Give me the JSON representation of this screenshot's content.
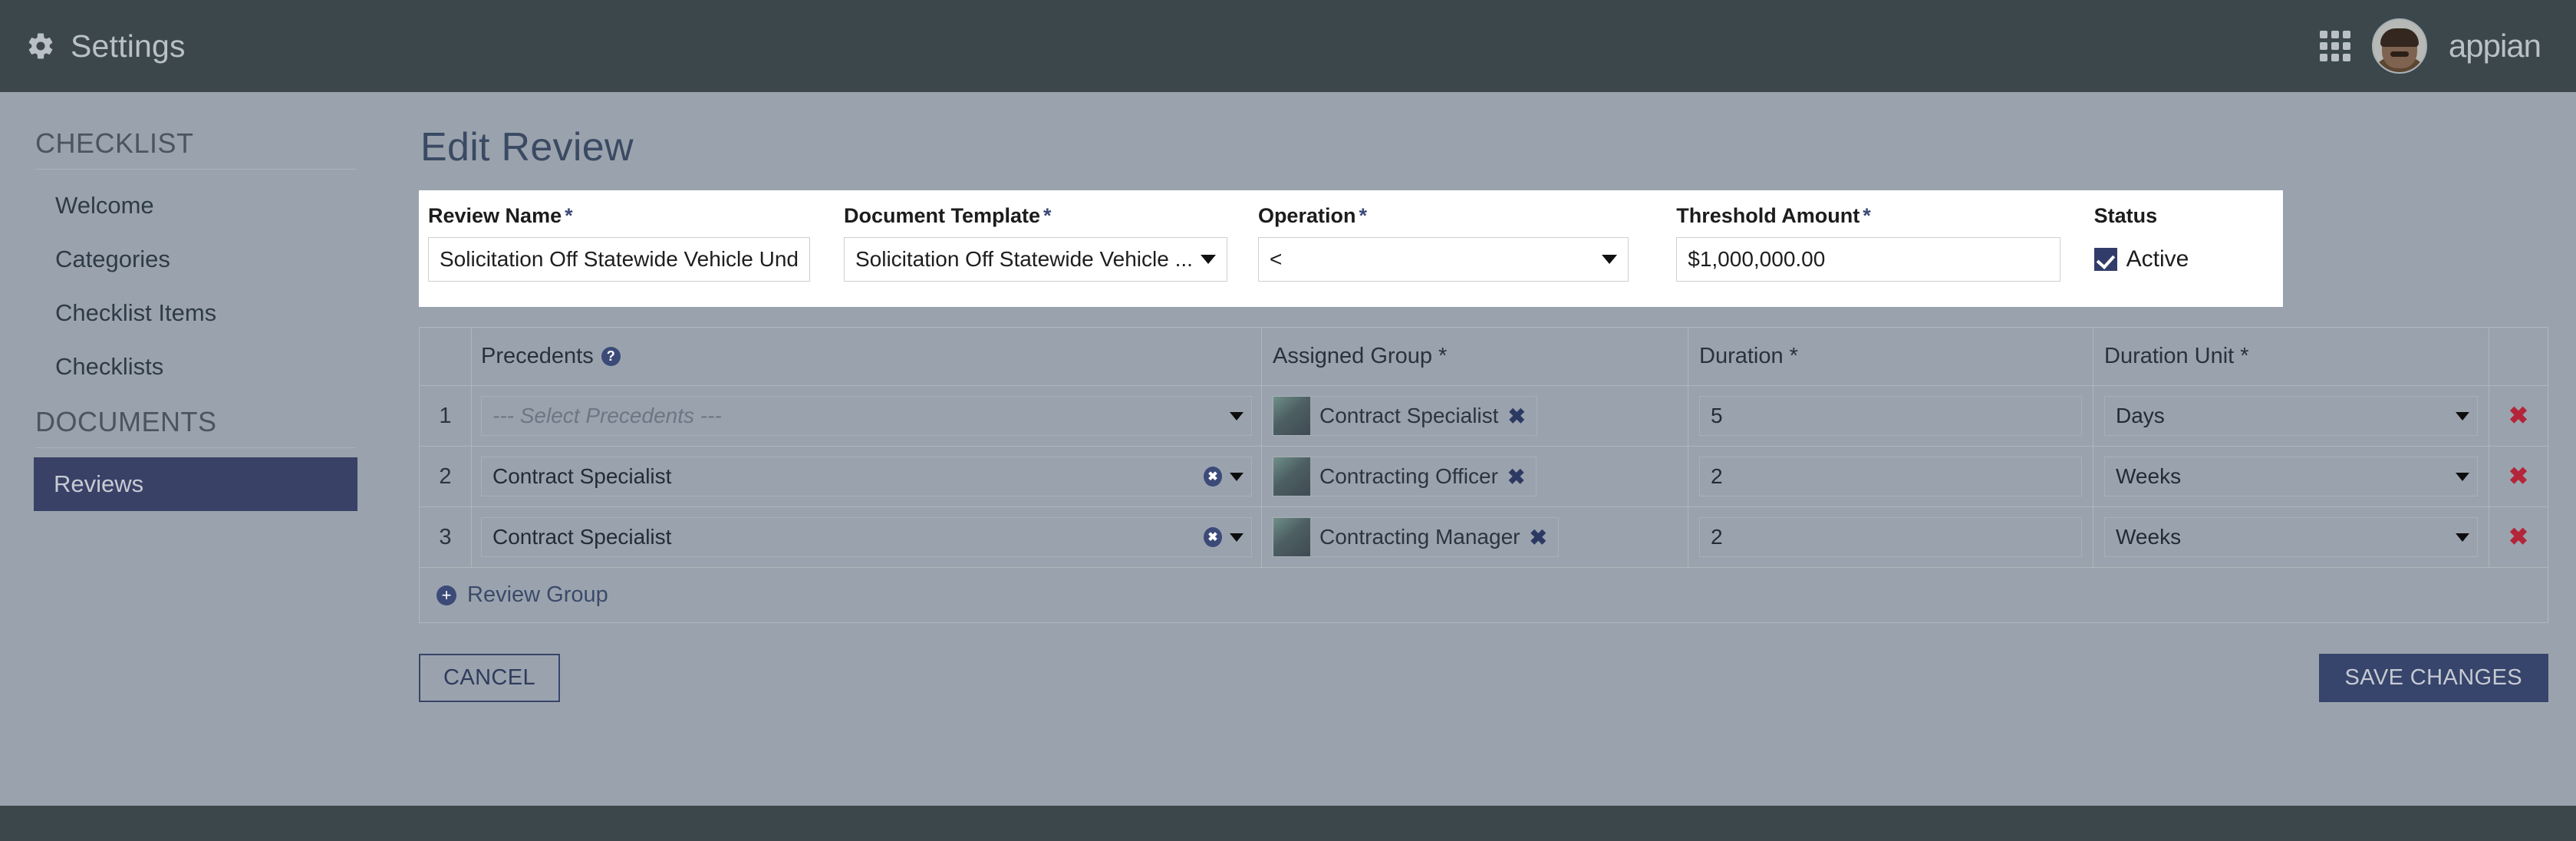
{
  "topbar": {
    "gear_icon": "gear-icon",
    "title": "Settings",
    "apps_icon": "grid-apps-icon",
    "avatar": "user-avatar",
    "brand": "appian"
  },
  "sidebar": {
    "sections": [
      {
        "label": "CHECKLIST",
        "items": [
          {
            "label": "Welcome",
            "active": false
          },
          {
            "label": "Categories",
            "active": false
          },
          {
            "label": "Checklist Items",
            "active": false
          },
          {
            "label": "Checklists",
            "active": false
          }
        ]
      },
      {
        "label": "DOCUMENTS",
        "items": [
          {
            "label": "Reviews",
            "active": true
          }
        ]
      }
    ]
  },
  "main": {
    "page_title": "Edit Review",
    "form": {
      "review_name": {
        "label": "Review Name",
        "required": "*",
        "value": "Solicitation Off Statewide Vehicle Und"
      },
      "document_template": {
        "label": "Document Template",
        "required": "*",
        "value": "Solicitation Off Statewide Vehicle ..."
      },
      "operation": {
        "label": "Operation",
        "required": "*",
        "value": "<"
      },
      "threshold_amount": {
        "label": "Threshold Amount",
        "required": "*",
        "value": "$1,000,000.00"
      },
      "status": {
        "label": "Status",
        "checkbox_label": "Active",
        "checked": true
      }
    },
    "grid": {
      "columns": {
        "number": "",
        "precedents": "Precedents",
        "precedents_help": "?",
        "assigned_group": "Assigned Group *",
        "duration": "Duration *",
        "duration_unit": "Duration Unit *"
      },
      "rows": [
        {
          "number": "1",
          "precedents": "--- Select Precedents ---",
          "precedents_is_placeholder": true,
          "assigned_group": "Contract Specialist",
          "duration": "5",
          "duration_unit": "Days"
        },
        {
          "number": "2",
          "precedents": "Contract Specialist",
          "precedents_is_placeholder": false,
          "assigned_group": "Contracting Officer",
          "duration": "2",
          "duration_unit": "Weeks"
        },
        {
          "number": "3",
          "precedents": "Contract Specialist",
          "precedents_is_placeholder": false,
          "assigned_group": "Contracting Manager",
          "duration": "2",
          "duration_unit": "Weeks"
        }
      ],
      "add_link": "Review Group",
      "add_icon": "plus-circle-icon",
      "delete_icon": "x-delete-icon",
      "chip_remove_icon": "x-remove-icon",
      "clear_icon": "clear-circle-icon"
    },
    "buttons": {
      "cancel": "CANCEL",
      "save": "SAVE CHANGES"
    }
  },
  "colors": {
    "topbar": "#3c474c",
    "page_bg": "#9aa3ad",
    "accent": "#37446b",
    "sidebar_active": "#394167",
    "delete_red": "#b4253a",
    "card_bg": "#ffffff"
  }
}
